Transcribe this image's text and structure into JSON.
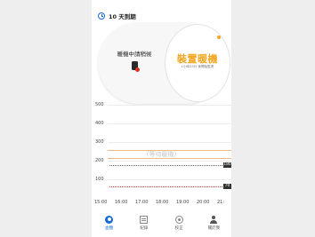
{
  "status": {
    "days_label": "10 天到期"
  },
  "pill": {
    "message": "暖機中請稍候",
    "main_label": "裝置暖機",
    "sub_label": "1小時13分 後開始監測"
  },
  "chart_data": {
    "type": "line",
    "y_ticks": [
      "500",
      "400",
      "300",
      "200",
      "100"
    ],
    "x_ticks": [
      "15:00",
      "16:00",
      "17:00",
      "18:00",
      "19:00",
      "20:00",
      "21:"
    ],
    "ylim": [
      0,
      500
    ],
    "high_target": 180,
    "low_target": 70,
    "high_label": "180",
    "low_label": "70",
    "placeholder": "(等待暖機)",
    "series": []
  },
  "nav": {
    "items": [
      {
        "label": "血糖",
        "icon": "home-icon",
        "active": true
      },
      {
        "label": "紀錄",
        "icon": "log-icon",
        "active": false
      },
      {
        "label": "校正",
        "icon": "calibrate-icon",
        "active": false
      },
      {
        "label": "關於我",
        "icon": "profile-icon",
        "active": false
      }
    ]
  },
  "colors": {
    "accent": "#1769d6",
    "warm": "#f3a51f",
    "low": "#c6463a"
  }
}
